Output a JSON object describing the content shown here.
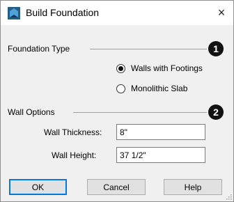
{
  "window": {
    "title": "Build Foundation",
    "close_glyph": "×",
    "app_icon": "chief-architect-app-icon"
  },
  "foundation_type": {
    "label": "Foundation Type",
    "badge": "1",
    "options": [
      {
        "label": "Walls with Footings",
        "checked": true
      },
      {
        "label": "Monolithic Slab",
        "checked": false
      }
    ]
  },
  "wall_options": {
    "label": "Wall Options",
    "badge": "2",
    "thickness": {
      "label": "Wall Thickness:",
      "value": "8\""
    },
    "height": {
      "label": "Wall Height:",
      "value": "37 1/2\""
    }
  },
  "buttons": {
    "ok": "OK",
    "cancel": "Cancel",
    "help": "Help"
  },
  "colors": {
    "accent": "#0078d7",
    "badge_bg": "#111111",
    "dialog_bg": "#f0f0f0"
  }
}
